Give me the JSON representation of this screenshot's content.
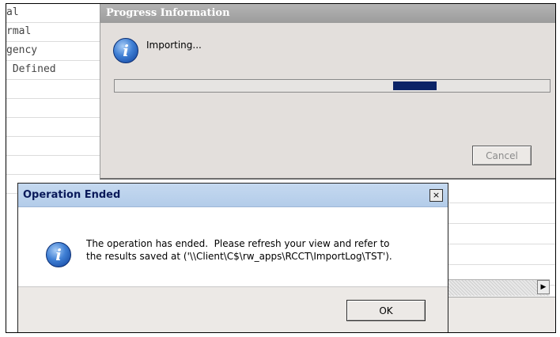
{
  "background_list": {
    "items": [
      "al",
      "rmal",
      "gency",
      " Defined",
      "",
      "",
      "",
      "",
      "",
      ""
    ]
  },
  "progress_dialog": {
    "title": "Progress Information",
    "message": "Importing...",
    "progress": {
      "indeterminate": true,
      "segment_start": 0.64,
      "segment_width": 0.1
    },
    "cancel_label": "Cancel",
    "cancel_enabled": false
  },
  "operation_dialog": {
    "title": "Operation Ended",
    "close_label": "×",
    "message_line1": "The operation has ended.  Please refresh your view and refer to",
    "message_line2": "the results saved at ('\\\\Client\\C$\\rw_apps\\RCCT\\ImportLog\\TST').",
    "ok_label": "OK"
  },
  "scrollbar": {
    "right_arrow": "▶"
  },
  "icons": {
    "info": "info-icon",
    "close": "close-icon",
    "arrow": "arrow-right-icon"
  },
  "colors": {
    "progress_fill": "#0b2366",
    "title_active": "#b3cce9",
    "title_inactive": "#9c9c9c",
    "dialog_bg": "#ece9e6"
  }
}
